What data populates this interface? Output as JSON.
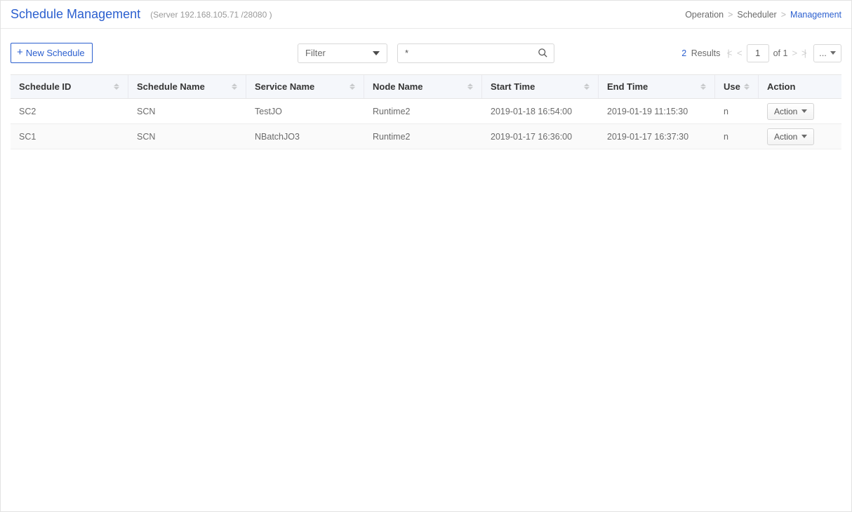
{
  "header": {
    "title": "Schedule Management",
    "server_info": "(Server 192.168.105.71 /28080 )"
  },
  "breadcrumb": {
    "level1": "Operation",
    "level2": "Scheduler",
    "level3": "Management"
  },
  "toolbar": {
    "new_label": "New Schedule",
    "filter_label": "Filter",
    "search_value": "*"
  },
  "results": {
    "count": "2",
    "label": "Results"
  },
  "pagination": {
    "current": "1",
    "of_label": "of",
    "total": "1",
    "more_label": "..."
  },
  "columns": {
    "schedule_id": "Schedule ID",
    "schedule_name": "Schedule Name",
    "service_name": "Service Name",
    "node_name": "Node Name",
    "start_time": "Start Time",
    "end_time": "End Time",
    "use": "Use",
    "action": "Action"
  },
  "action_button_label": "Action",
  "rows": [
    {
      "schedule_id": "SC2",
      "schedule_name": "SCN",
      "service_name": "TestJO",
      "node_name": "Runtime2",
      "start_time": "2019-01-18 16:54:00",
      "end_time": "2019-01-19 11:15:30",
      "use": "n"
    },
    {
      "schedule_id": "SC1",
      "schedule_name": "SCN",
      "service_name": "NBatchJO3",
      "node_name": "Runtime2",
      "start_time": "2019-01-17 16:36:00",
      "end_time": "2019-01-17 16:37:30",
      "use": "n"
    }
  ]
}
